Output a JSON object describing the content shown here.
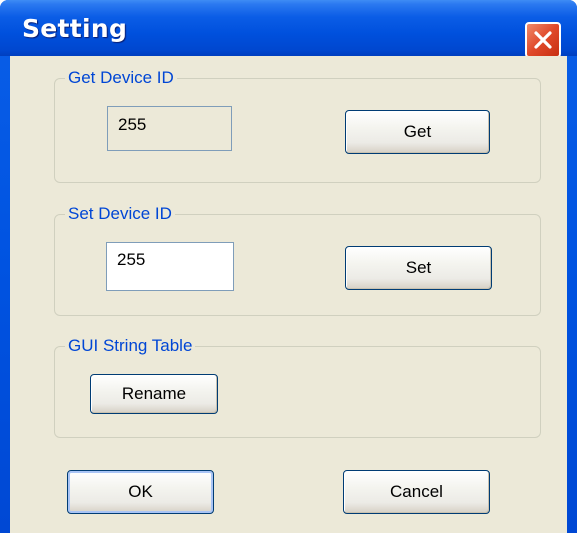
{
  "window": {
    "title": "Setting"
  },
  "get_device_id": {
    "legend": "Get Device ID",
    "value": "255",
    "get_label": "Get"
  },
  "set_device_id": {
    "legend": "Set Device ID",
    "value": "255",
    "set_label": "Set"
  },
  "gui_string_table": {
    "legend": "GUI String Table",
    "rename_label": "Rename"
  },
  "footer": {
    "ok_label": "OK",
    "cancel_label": "Cancel"
  },
  "icons": {
    "close": "close-icon"
  },
  "colors": {
    "titlebar": "#0053e1",
    "client_background": "#ece9d8",
    "legend_text": "#0046d5",
    "close_button": "#e0492a"
  }
}
